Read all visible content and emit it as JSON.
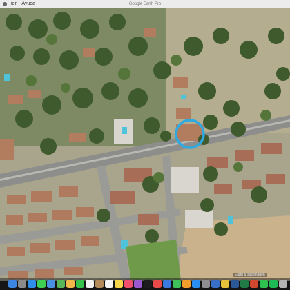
{
  "menubar": {
    "menu_items": [
      "ion",
      "Ayuda"
    ],
    "window_title": "Google Earth Pro"
  },
  "map": {
    "highlight_color": "#2fa9e0",
    "attribution": "Earth & sus imagen"
  },
  "dock": {
    "apps": [
      {
        "name": "finder-icon",
        "color": "#3b86e0"
      },
      {
        "name": "launchpad-icon",
        "color": "#8a8a8a"
      },
      {
        "name": "safari-icon",
        "color": "#2f8fe8"
      },
      {
        "name": "messages-icon",
        "color": "#3fcf52"
      },
      {
        "name": "mail-icon",
        "color": "#4a90e2"
      },
      {
        "name": "maps-icon",
        "color": "#5ab45a"
      },
      {
        "name": "photos-icon",
        "color": "#f0b84a"
      },
      {
        "name": "facetime-icon",
        "color": "#35c24a"
      },
      {
        "name": "calendar-icon",
        "color": "#f2f2f2"
      },
      {
        "name": "contacts-icon",
        "color": "#b48a5a"
      },
      {
        "name": "reminders-icon",
        "color": "#f5f5f5"
      },
      {
        "name": "notes-icon",
        "color": "#f6d64a"
      },
      {
        "name": "music-icon",
        "color": "#f0506e"
      },
      {
        "name": "podcasts-icon",
        "color": "#9b59d0"
      },
      {
        "name": "tv-icon",
        "color": "#1c1c1c"
      },
      {
        "name": "news-icon",
        "color": "#e84a4a"
      },
      {
        "name": "keynote-icon",
        "color": "#3a7ae0"
      },
      {
        "name": "numbers-icon",
        "color": "#3fbf5a"
      },
      {
        "name": "pages-icon",
        "color": "#f39c2e"
      },
      {
        "name": "app-store-icon",
        "color": "#2a8ef0"
      },
      {
        "name": "system-preferences-icon",
        "color": "#8e8e93"
      },
      {
        "name": "google-earth-icon",
        "color": "#3a6fc8"
      },
      {
        "name": "chrome-icon",
        "color": "#e8c23a"
      },
      {
        "name": "word-icon",
        "color": "#2b5797"
      },
      {
        "name": "excel-icon",
        "color": "#1f7a44"
      },
      {
        "name": "powerpoint-icon",
        "color": "#d2472f"
      },
      {
        "name": "whatsapp-icon",
        "color": "#30c04f"
      },
      {
        "name": "spotify-icon",
        "color": "#1db954"
      },
      {
        "name": "trash-icon",
        "color": "#b5b5b5"
      }
    ]
  }
}
